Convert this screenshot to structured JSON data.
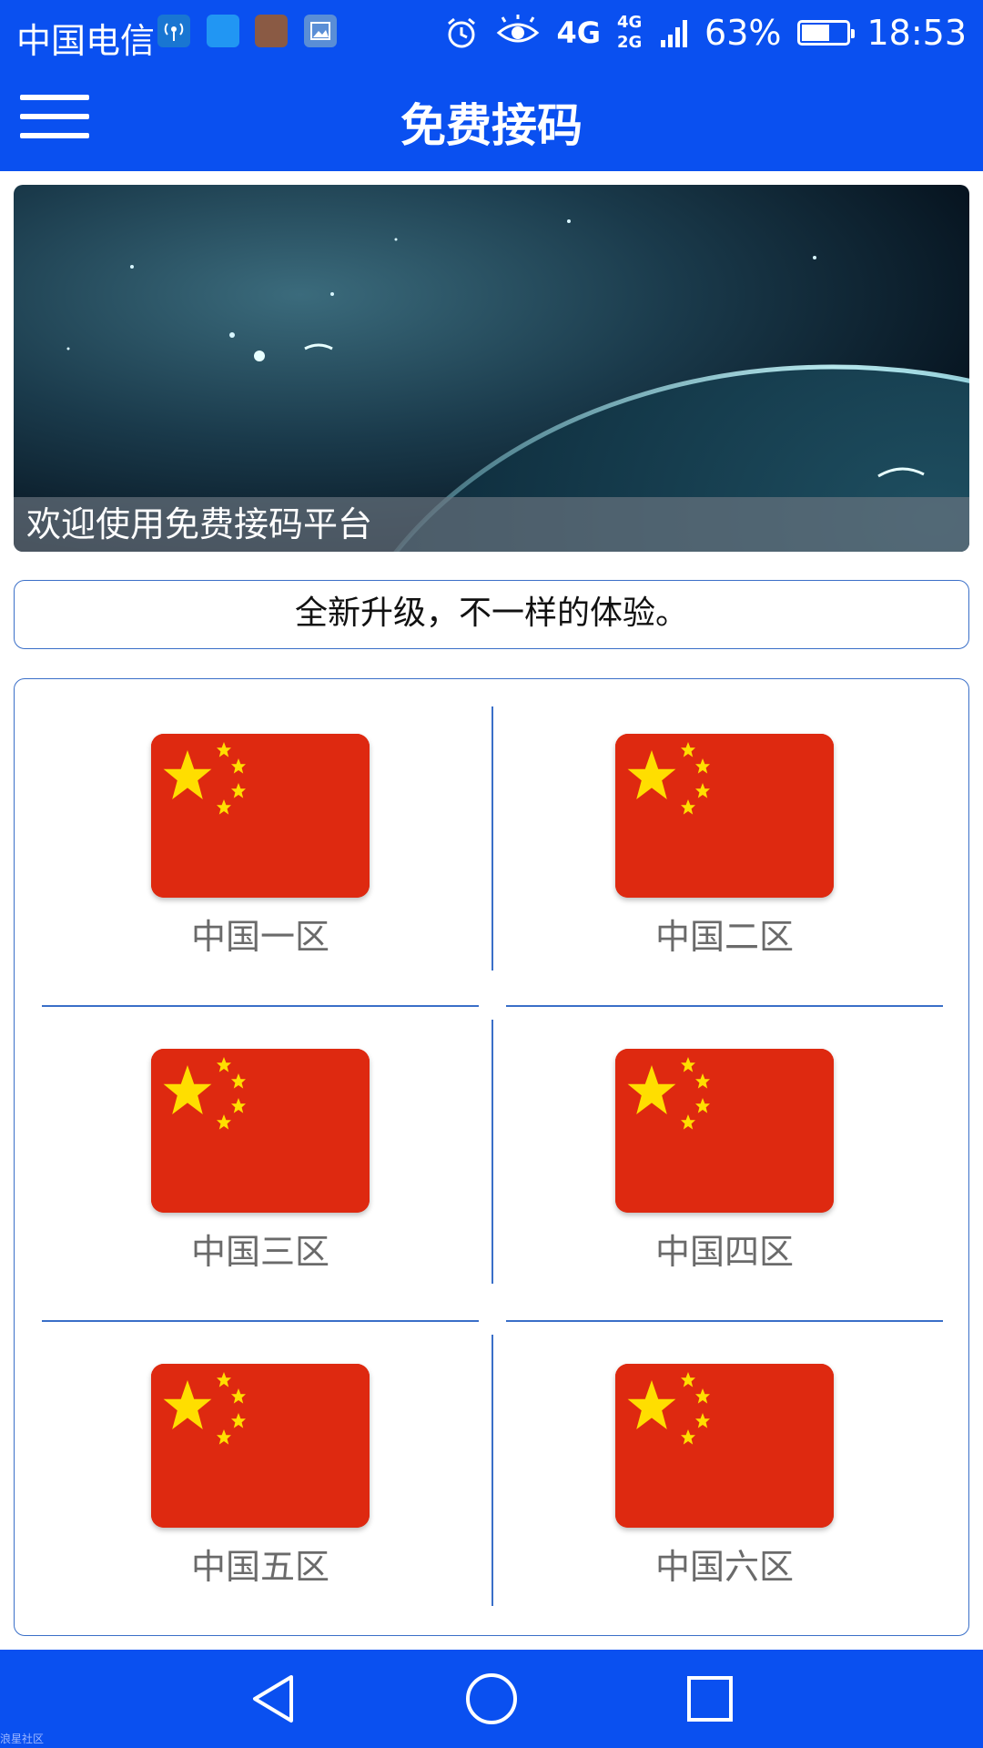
{
  "status_bar": {
    "carrier": "中国电信",
    "network_4g": "4G",
    "network_4g2g": "4G 2G",
    "battery_percent": "63%",
    "battery_level": 0.63,
    "time": "18:53"
  },
  "app_bar": {
    "title": "免费接码",
    "menu_icon": "hamburger-menu-icon"
  },
  "banner": {
    "caption": "欢迎使用免费接码平台"
  },
  "notice": {
    "text": "全新升级，不一样的体验。"
  },
  "regions": [
    {
      "label": "中国一区",
      "flag": "china-flag-icon"
    },
    {
      "label": "中国二区",
      "flag": "china-flag-icon"
    },
    {
      "label": "中国三区",
      "flag": "china-flag-icon"
    },
    {
      "label": "中国四区",
      "flag": "china-flag-icon"
    },
    {
      "label": "中国五区",
      "flag": "china-flag-icon"
    },
    {
      "label": "中国六区",
      "flag": "china-flag-icon"
    }
  ],
  "nav_bar": {
    "back_icon": "back-triangle-icon",
    "home_icon": "home-circle-icon",
    "recents_icon": "recents-square-icon"
  },
  "watermark": "浪星社区",
  "colors": {
    "primary": "#0a50f0",
    "border": "#3a6fc8",
    "flag_red": "#de2910",
    "flag_yellow": "#ffde00"
  }
}
